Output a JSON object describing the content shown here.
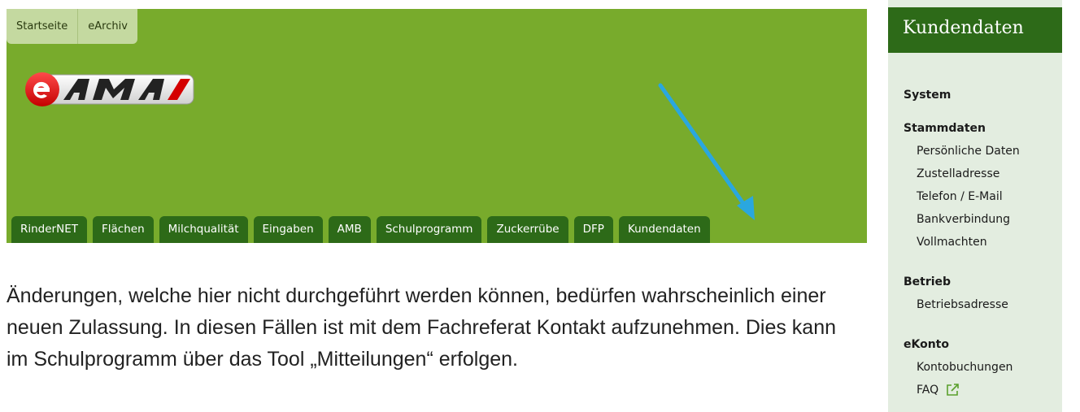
{
  "top_tabs": [
    {
      "label": "Startseite"
    },
    {
      "label": "eArchiv"
    }
  ],
  "logo": {
    "text": "eAMA",
    "icon": "eama-logo"
  },
  "main_nav": [
    {
      "label": "RinderNET"
    },
    {
      "label": "Flächen"
    },
    {
      "label": "Milchqualität"
    },
    {
      "label": "Eingaben"
    },
    {
      "label": "AMB"
    },
    {
      "label": "Schulprogramm"
    },
    {
      "label": "Zuckerrübe"
    },
    {
      "label": "DFP"
    },
    {
      "label": "Kundendaten"
    }
  ],
  "annotation": {
    "icon": "arrow-pointer",
    "color": "#2aa7df"
  },
  "body_text": "Änderungen, welche hier nicht durchgeführt werden können, bedürfen wahrscheinlich einer neuen Zulassung. In diesen Fällen ist mit dem Fachreferat Kontakt aufzunehmen. Dies kann im Schulprogramm über das Tool „Mitteilungen“ erfolgen.",
  "sidebar": {
    "title": "Kundendaten",
    "groups": [
      {
        "heading": "System",
        "items": []
      },
      {
        "heading": "Stammdaten",
        "items": [
          "Persönliche Daten",
          "Zustelladresse",
          "Telefon / E-Mail",
          "Bankverbindung",
          "Vollmachten"
        ]
      },
      {
        "heading": "Betrieb",
        "items": [
          "Betriebsadresse"
        ]
      },
      {
        "heading": "eKonto",
        "items": [
          "Kontobuchungen",
          "FAQ"
        ]
      }
    ]
  },
  "colors": {
    "banner": "#78ab2c",
    "nav_tab": "#2d6a18",
    "sidebar_bg": "#e3ede0",
    "sidebar_title_bg": "#2d6a18"
  }
}
